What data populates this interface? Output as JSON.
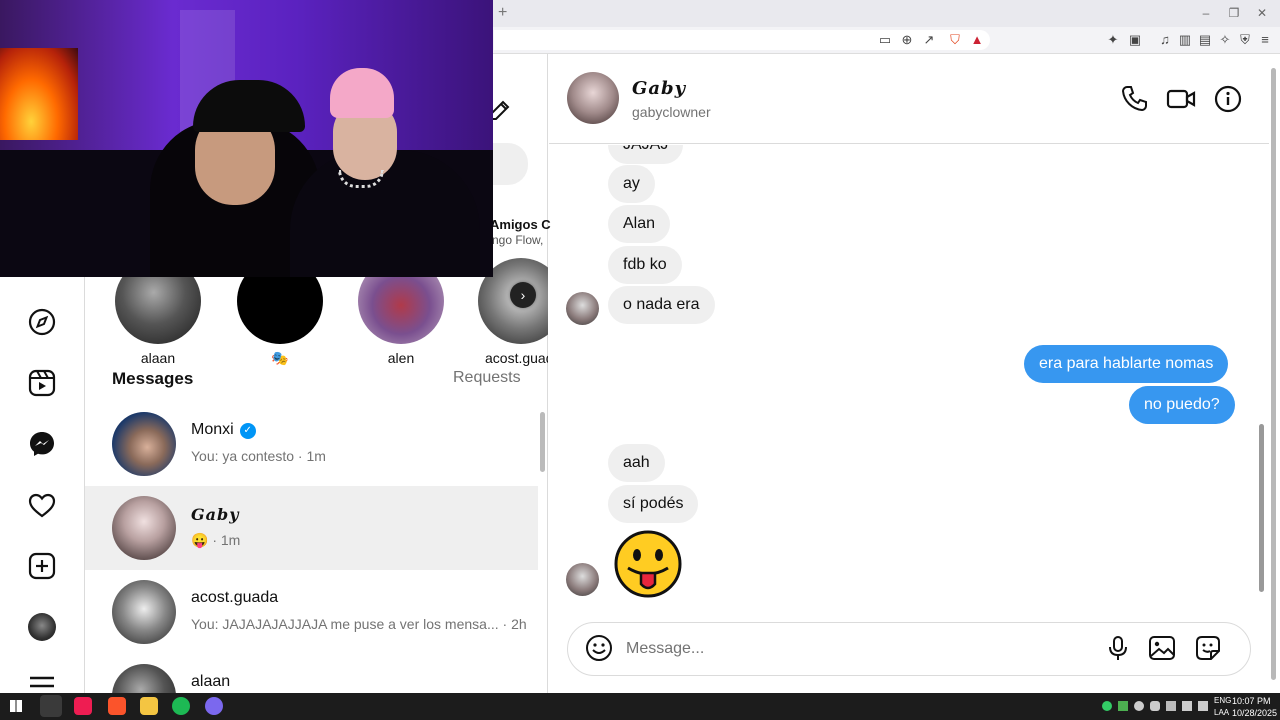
{
  "browser": {
    "new_tab": "+",
    "window_min": "–",
    "window_restore": "❐",
    "window_close": "✕"
  },
  "instagram": {
    "story_header": {
      "title": "Amigos C",
      "subtitle": "ngo Flow,"
    },
    "stories": [
      {
        "name": "alaan"
      },
      {
        "name": "🎭"
      },
      {
        "name": "alen"
      },
      {
        "name": "acost.guada"
      }
    ],
    "story_next": "›",
    "messages_title": "Messages",
    "requests_label": "Requests",
    "conversations": [
      {
        "name": "Monxi",
        "verified": "✓",
        "preview": "You: ya contesto · 1m"
      },
      {
        "name": "Gaby",
        "preview": "😛 · 1m"
      },
      {
        "name": "acost.guada",
        "preview": "You: JAJAJAJAJJAJA me puse a ver los mensa... · 2h"
      },
      {
        "name": "alaan",
        "preview": ""
      }
    ]
  },
  "chat": {
    "name": "Gaby",
    "username": "gabyclowner",
    "messages": [
      {
        "from": "them",
        "text": "JAJAJ"
      },
      {
        "from": "them",
        "text": "ay"
      },
      {
        "from": "them",
        "text": "Alan"
      },
      {
        "from": "them",
        "text": "fdb ko"
      },
      {
        "from": "them",
        "text": "o nada era"
      },
      {
        "from": "me",
        "text": "era para hablarte nomas"
      },
      {
        "from": "me",
        "text": "no puedo?"
      },
      {
        "from": "them",
        "text": "aah"
      },
      {
        "from": "them",
        "text": "sí podés"
      },
      {
        "from": "them",
        "text": "😛"
      }
    ],
    "composer_placeholder": "Message..."
  },
  "taskbar": {
    "lang_top": "ENG",
    "lang_bottom": "LAA",
    "time": "10:07 PM",
    "date": "10/28/2025"
  },
  "colors": {
    "accent": "#3797f0",
    "verified": "#0095f6",
    "incoming_bubble": "#efefef"
  }
}
